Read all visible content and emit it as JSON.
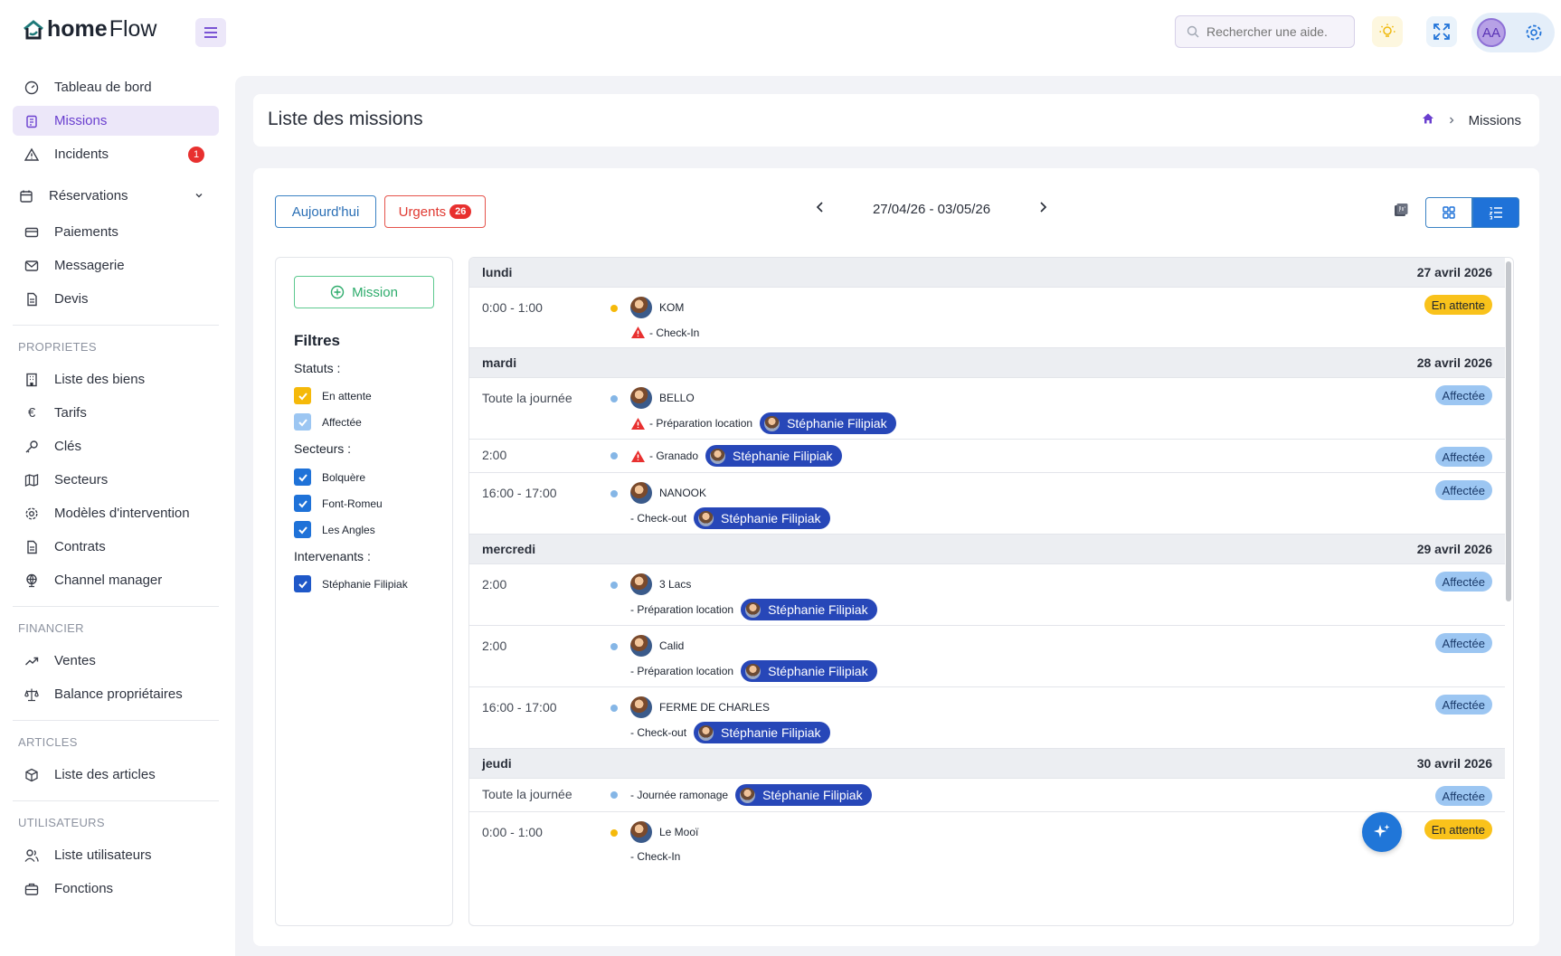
{
  "app": {
    "logo_bold": "home",
    "logo_regular": "Flow"
  },
  "topbar": {
    "search_placeholder": "Rechercher une aide.",
    "user_initials": "AA"
  },
  "sidebar": {
    "main": [
      {
        "label": "Tableau de bord",
        "icon": "dashboard-icon"
      },
      {
        "label": "Missions",
        "icon": "clipboard-icon",
        "active": true
      },
      {
        "label": "Incidents",
        "icon": "warning-icon",
        "badge": "1"
      },
      {
        "label": "Réservations",
        "icon": "calendar-icon",
        "has_chevron": true
      },
      {
        "label": "Paiements",
        "icon": "card-icon"
      },
      {
        "label": "Messagerie",
        "icon": "mail-icon"
      },
      {
        "label": "Devis",
        "icon": "document-icon"
      }
    ],
    "proprietes_title": "PROPRIETES",
    "proprietes": [
      {
        "label": "Liste des biens",
        "icon": "building-icon"
      },
      {
        "label": "Tarifs",
        "icon": "euro-icon"
      },
      {
        "label": "Clés",
        "icon": "key-icon"
      },
      {
        "label": "Secteurs",
        "icon": "map-icon"
      },
      {
        "label": "Modèles d'intervention",
        "icon": "gear-icon"
      },
      {
        "label": "Contrats",
        "icon": "document-icon"
      },
      {
        "label": "Channel manager",
        "icon": "globe-icon"
      }
    ],
    "financier_title": "FINANCIER",
    "financier": [
      {
        "label": "Ventes",
        "icon": "trend-icon"
      },
      {
        "label": "Balance propriétaires",
        "icon": "scale-icon"
      }
    ],
    "articles_title": "ARTICLES",
    "articles": [
      {
        "label": "Liste des articles",
        "icon": "box-icon"
      }
    ],
    "utilisateurs_title": "UTILISATEURS",
    "utilisateurs": [
      {
        "label": "Liste utilisateurs",
        "icon": "users-icon"
      },
      {
        "label": "Fonctions",
        "icon": "briefcase-icon"
      }
    ]
  },
  "page": {
    "title": "Liste des missions",
    "breadcrumb_current": "Missions"
  },
  "toolbar": {
    "today_label": "Aujourd'hui",
    "urgent_label": "Urgents",
    "urgent_count": "26",
    "date_range": "27/04/26 - 03/05/26"
  },
  "filters": {
    "add_mission_label": "Mission",
    "title": "Filtres",
    "statuts_title": "Statuts :",
    "statuts": [
      "En attente",
      "Affectée"
    ],
    "secteurs_title": "Secteurs :",
    "secteurs": [
      "Bolquère",
      "Font-Romeu",
      "Les Angles"
    ],
    "intervenants_title": "Intervenants :",
    "intervenants": [
      "Stéphanie Filipiak"
    ]
  },
  "days": [
    {
      "day": "lundi",
      "date": "27 avril 2026"
    },
    {
      "day": "mardi",
      "date": "28 avril 2026"
    },
    {
      "day": "mercredi",
      "date": "29 avril 2026"
    },
    {
      "day": "jeudi",
      "date": "30 avril 2026"
    }
  ],
  "missions": [
    {
      "time": "0:00 - 1:00",
      "property": "KOM",
      "detail": "- Check-In",
      "warning": true,
      "status": "En attente"
    },
    {
      "time": "Toute la journée",
      "property": "BELLO",
      "detail": "- Préparation location",
      "warning": true,
      "assignee": "Stéphanie Filipiak",
      "status": "Affectée"
    },
    {
      "time": "2:00",
      "detail": "- Granado",
      "warning": true,
      "assignee": "Stéphanie Filipiak",
      "status": "Affectée"
    },
    {
      "time": "16:00 - 17:00",
      "property": "NANOOK",
      "detail": "- Check-out",
      "assignee": "Stéphanie Filipiak",
      "status": "Affectée"
    },
    {
      "time": "2:00",
      "property": "3 Lacs",
      "detail": "- Préparation location",
      "assignee": "Stéphanie Filipiak",
      "status": "Affectée"
    },
    {
      "time": "2:00",
      "property": "Calid",
      "detail": "- Préparation location",
      "assignee": "Stéphanie Filipiak",
      "status": "Affectée"
    },
    {
      "time": "16:00 - 17:00",
      "property": "FERME DE CHARLES",
      "detail": "- Check-out",
      "assignee": "Stéphanie Filipiak",
      "status": "Affectée"
    },
    {
      "time": "Toute la journée",
      "detail": "- Journée ramonage",
      "assignee": "Stéphanie Filipiak",
      "status": "Affectée"
    },
    {
      "time": "0:00 - 1:00",
      "property": "Le Mooï",
      "detail": "- Check-In",
      "status": "En attente"
    }
  ],
  "colors": {
    "accent": "#6a3fcf",
    "primary_blue": "#1f72d8",
    "pill_blue": "#2747b8",
    "waiting": "#f9c21b",
    "assigned": "#9cc6f2",
    "danger": "#e8302f",
    "success": "#2eac6c"
  }
}
